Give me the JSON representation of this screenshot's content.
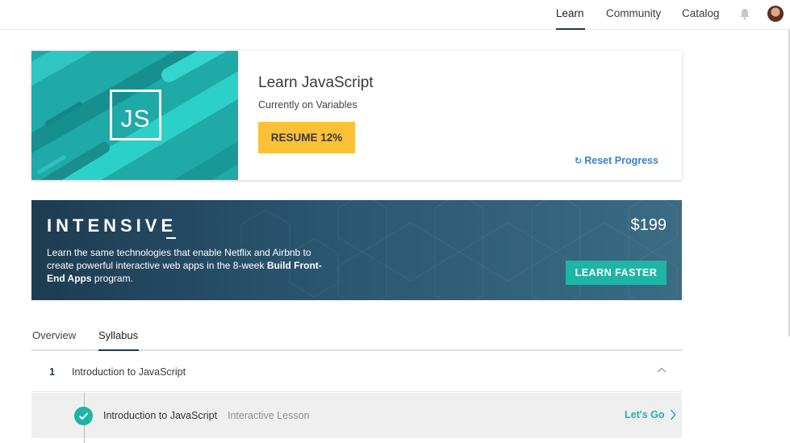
{
  "nav": {
    "items": [
      {
        "label": "Learn",
        "active": true
      },
      {
        "label": "Community",
        "active": false
      },
      {
        "label": "Catalog",
        "active": false
      }
    ],
    "bell_icon": "bell-icon",
    "avatar_icon": "user-avatar"
  },
  "course": {
    "logo_text": "JS",
    "title": "Learn JavaScript",
    "status": "Currently on Variables",
    "resume_label": "RESUME 12%",
    "progress_percent": 12,
    "reset_icon": "refresh-icon",
    "reset_label": "Reset Progress",
    "colors": {
      "hero": "#1fa9a7",
      "resume": "#fdc137",
      "link": "#3a80c8"
    }
  },
  "banner": {
    "logo_text": "INTENSIVE",
    "desc_plain": "Learn the same technologies that enable Netflix and Airbnb to create powerful interactive web apps in the 8-week ",
    "desc_bold": "Build Front-End Apps",
    "desc_tail": " program.",
    "price": "$199",
    "cta_label": "LEARN FASTER",
    "colors": {
      "cta": "#1fb5a6",
      "bg": "#2a5670"
    }
  },
  "tabs": [
    {
      "label": "Overview",
      "active": false
    },
    {
      "label": "Syllabus",
      "active": true
    }
  ],
  "syllabus": {
    "unit": {
      "number": "1",
      "title": "Introduction to JavaScript",
      "expanded": true
    },
    "lessons": [
      {
        "title": "Introduction to JavaScript",
        "type": "Interactive Lesson",
        "completed": true,
        "action": "Let's Go"
      }
    ]
  }
}
